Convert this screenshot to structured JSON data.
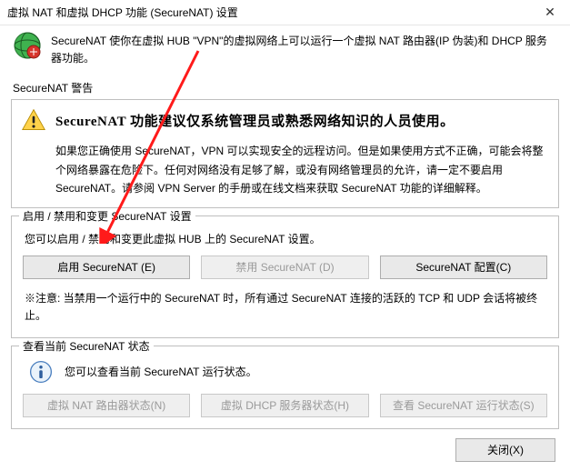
{
  "window": {
    "title": "虚拟 NAT 和虚拟 DHCP 功能 (SecureNAT) 设置",
    "close_glyph": "✕"
  },
  "intro": "SecureNAT 使你在虚拟 HUB \"VPN\"的虚拟网络上可以运行一个虚拟 NAT 路由器(IP 伪装)和 DHCP 服务器功能。",
  "warning_label": "SecureNAT 警告",
  "warning": {
    "headline": "SecureNAT 功能建议仅系统管理员或熟悉网络知识的人员使用。",
    "body": "如果您正确使用 SecureNAT，VPN 可以实现安全的远程访问。但是如果使用方式不正确，可能会将整个网络暴露在危险下。任何对网络没有足够了解，或没有网络管理员的允许，请一定不要启用 SecureNAT。请参阅 VPN Server 的手册或在线文档来获取 SecureNAT 功能的详细解释。"
  },
  "manage": {
    "legend": "启用 / 禁用和变更 SecureNAT 设置",
    "desc": "您可以启用 / 禁用和变更此虚拟 HUB 上的 SecureNAT 设置。",
    "enable_btn": "启用 SecureNAT (E)",
    "disable_btn": "禁用 SecureNAT (D)",
    "config_btn": "SecureNAT 配置(C)",
    "note": "※注意: 当禁用一个运行中的 SecureNAT 时，所有通过 SecureNAT 连接的活跃的 TCP 和 UDP 会话将被终止。"
  },
  "status": {
    "legend": "查看当前 SecureNAT 状态",
    "desc": "您可以查看当前 SecureNAT 运行状态。",
    "router_btn": "虚拟 NAT 路由器状态(N)",
    "dhcp_btn": "虚拟 DHCP 服务器状态(H)",
    "run_btn": "查看 SecureNAT 运行状态(S)"
  },
  "footer": {
    "close_btn": "关闭(X)"
  }
}
